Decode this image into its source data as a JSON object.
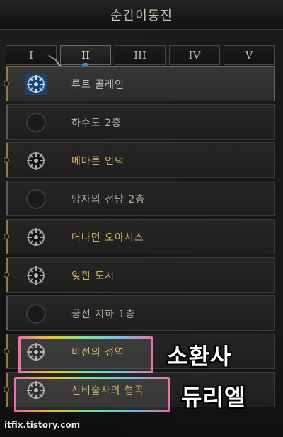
{
  "window": {
    "title": "순간이동진"
  },
  "tabs": [
    {
      "label": "I"
    },
    {
      "label": "II"
    },
    {
      "label": "III"
    },
    {
      "label": "IV"
    },
    {
      "label": "V"
    }
  ],
  "waypoints": [
    {
      "label": "루트 골레인",
      "state": "current",
      "icon": "waypoint-active-icon"
    },
    {
      "label": "하수도 2층",
      "state": "locked",
      "icon": "empty-circle-icon"
    },
    {
      "label": "메마른 언덕",
      "state": "unlocked",
      "icon": "waypoint-icon"
    },
    {
      "label": "망자의 전당 2층",
      "state": "locked",
      "icon": "empty-circle-icon"
    },
    {
      "label": "머나먼 오아시스",
      "state": "unlocked",
      "icon": "waypoint-icon"
    },
    {
      "label": "잊힌 도시",
      "state": "unlocked",
      "icon": "waypoint-icon"
    },
    {
      "label": "궁전 지하 1층",
      "state": "locked",
      "icon": "empty-circle-icon"
    },
    {
      "label": "비전의 성역",
      "state": "unlocked",
      "icon": "waypoint-icon"
    },
    {
      "label": "신비술사의 협곡",
      "state": "unlocked",
      "icon": "waypoint-icon"
    }
  ],
  "annotations": {
    "first": "소환사",
    "second": "듀리엘"
  },
  "watermark": "itfix.tistory.com",
  "colors": {
    "gold_text": "#d6b25c",
    "normal_text": "#b8b0a0",
    "active_blue": "#3a88c9",
    "highlight_gradient": [
      "#ff66aa",
      "#ffd200",
      "#66ff99",
      "#66ccff"
    ]
  }
}
